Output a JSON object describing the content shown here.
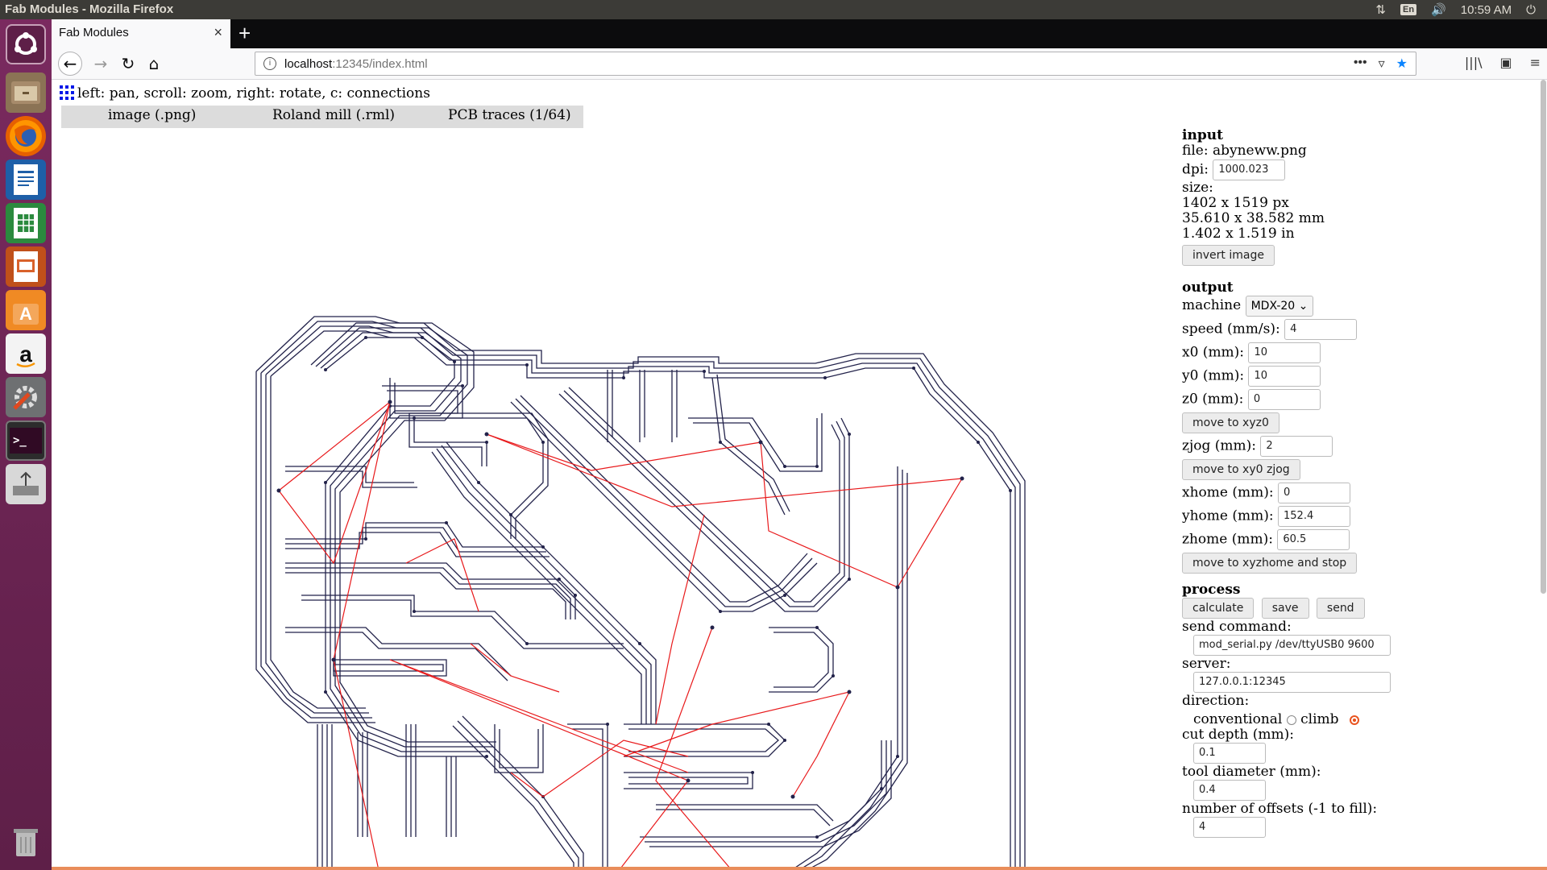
{
  "os": {
    "window_title": "Fab Modules - Mozilla Firefox",
    "clock": "10:59 AM",
    "lang": "En"
  },
  "browser": {
    "tab_title": "Fab Modules",
    "url_host": "localhost",
    "url_rest": ":12345/index.html"
  },
  "page": {
    "hint": "left: pan, scroll: zoom, right: rotate, c: connections",
    "menu": [
      "image (.png)",
      "Roland mill (.rml)",
      "PCB traces (1/64)"
    ],
    "input": {
      "heading": "input",
      "file": "file: abyneww.png",
      "dpi_label": "dpi:",
      "dpi_value": "1000.023",
      "size_label": "size:",
      "size_px": "1402 x 1519 px",
      "size_mm": "35.610 x 38.582 mm",
      "size_in": "1.402 x 1.519 in",
      "invert_button": "invert image"
    },
    "output": {
      "heading": "output",
      "machine_label": "machine",
      "machine_value": "MDX-20",
      "speed_label": "speed (mm/s):",
      "speed_value": "4",
      "x0_label": "x0 (mm):",
      "x0_value": "10",
      "y0_label": "y0 (mm):",
      "y0_value": "10",
      "z0_label": "z0 (mm):",
      "z0_value": "0",
      "move_xyz0_button": "move to xyz0",
      "zjog_label": "zjog (mm):",
      "zjog_value": "2",
      "move_zjog_button": "move to xy0 zjog",
      "xhome_label": "xhome (mm):",
      "xhome_value": "0",
      "yhome_label": "yhome (mm):",
      "yhome_value": "152.4",
      "zhome_label": "zhome (mm):",
      "zhome_value": "60.5",
      "move_home_button": "move to xyzhome and stop"
    },
    "process": {
      "heading": "process",
      "calculate_button": "calculate",
      "save_button": "save",
      "send_button": "send",
      "send_command_label": "send command:",
      "send_command_value": "mod_serial.py /dev/ttyUSB0 9600",
      "server_label": "server:",
      "server_value": "127.0.0.1:12345",
      "direction_label": "direction:",
      "conventional_label": "conventional",
      "climb_label": "climb",
      "cut_depth_label": "cut depth (mm):",
      "cut_depth_value": "0.1",
      "tool_diameter_label": "tool diameter (mm):",
      "tool_diameter_value": "0.4",
      "offsets_label": "number of offsets (-1 to fill):",
      "offsets_value": "4"
    }
  }
}
